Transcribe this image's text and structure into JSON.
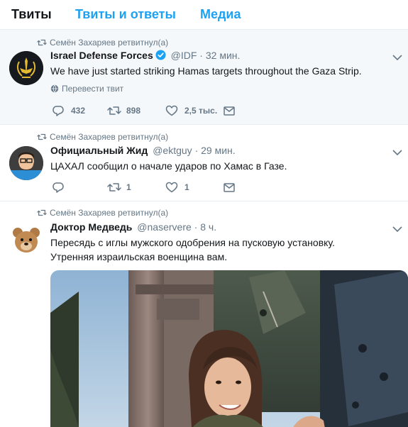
{
  "tabs": [
    {
      "label": "Твиты"
    },
    {
      "label": "Твиты и ответы"
    },
    {
      "label": "Медиа"
    }
  ],
  "colors": {
    "accent": "#1da1f2",
    "secondary_text": "#657786",
    "border": "#e6ecf0"
  },
  "tweets": [
    {
      "retweet_text": "Семён Захаряев ретвитнул(а)",
      "name": "Israel Defense Forces",
      "verified": true,
      "handle": "@IDF",
      "separator": "·",
      "time": "32 мин.",
      "text": "We have just started striking Hamas targets throughout the Gaza Strip.",
      "translate_label": "Перевести твит",
      "replies": "432",
      "retweets": "898",
      "likes": "2,5 тыс.",
      "avatar_icon": "idf-emblem-icon"
    },
    {
      "retweet_text": "Семён Захаряев ретвитнул(а)",
      "name": "Официальный Жид",
      "handle": "@ektguy",
      "separator": "·",
      "time": "29 мин.",
      "text": "ЦАХАЛ сообщил о начале ударов по Хамас в Газе.",
      "replies": "",
      "retweets": "1",
      "likes": "1",
      "avatar_icon": "cartoon-bearded-man-icon"
    },
    {
      "retweet_text": "Семён Захаряев ретвитнул(а)",
      "name": "Доктор Медведь",
      "handle": "@naservere",
      "separator": "·",
      "time": "8 ч.",
      "text_line1": "Пересядь с иглы мужского одобрения на пусковую установку.",
      "text_line2": "Утренняя израильская военщина вам.",
      "avatar_icon": "teddy-bear-icon",
      "media_icon": "soldier-photo-image"
    }
  ]
}
